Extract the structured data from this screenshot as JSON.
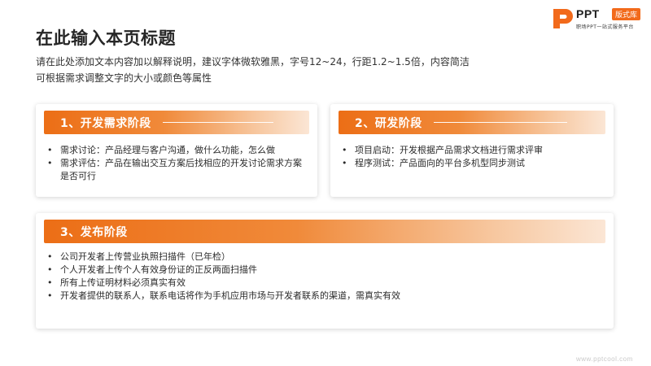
{
  "logo": {
    "brand": "PPT",
    "badge": "版式库",
    "tagline": "职场PPT一站式服务平台",
    "brand_color": "#f26a1b"
  },
  "title": "在此输入本页标题",
  "subtitle": [
    "请在此处添加文本内容加以解释说明，建议字体微软雅黑，字号12~24，行距1.2~1.5倍，内容简洁",
    "可根据需求调整文字的大小或颜色等属性"
  ],
  "accent_color": "#ec6e16",
  "cards": [
    {
      "title": "1、开发需求阶段",
      "items": [
        "需求讨论：产品经理与客户沟通，做什么功能，怎么做",
        "需求评估：产品在输出交互方案后找相应的开发讨论需求方案是否可行"
      ]
    },
    {
      "title": "2、研发阶段",
      "items": [
        "项目启动：开发根据产品需求文档进行需求评审",
        "程序测试：产品面向的平台多机型同步测试"
      ]
    },
    {
      "title": "3、发布阶段",
      "items": [
        "公司开发者上传营业执照扫描件（已年检）",
        "个人开发者上传个人有效身份证的正反两面扫描件",
        "所有上传证明材料必须真实有效",
        "开发者提供的联系人，联系电话将作为手机应用市场与开发者联系的渠道，需真实有效"
      ]
    }
  ],
  "watermark": "www.pptcool.com"
}
